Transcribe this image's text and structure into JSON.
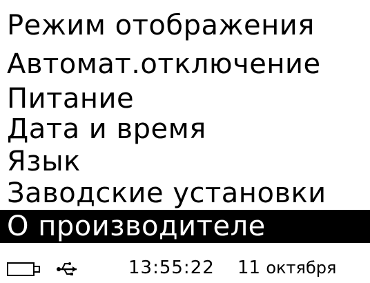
{
  "menu": {
    "items": [
      {
        "label": "Режим отображения"
      },
      {
        "label": "Автомат.отключение"
      },
      {
        "label": "Питание"
      },
      {
        "label": "Дата и время"
      },
      {
        "label": "Язык"
      },
      {
        "label": "Заводские установки"
      },
      {
        "label": "О производителе"
      }
    ],
    "selected_index": 6
  },
  "status": {
    "battery_icon": "battery-icon",
    "usb_icon": "usb-icon",
    "time": "13:55:22",
    "day": "11",
    "month": "октября"
  },
  "colors": {
    "background": "#ffffff",
    "foreground": "#000000",
    "selection_background": "#000000",
    "selection_foreground": "#ffffff"
  }
}
